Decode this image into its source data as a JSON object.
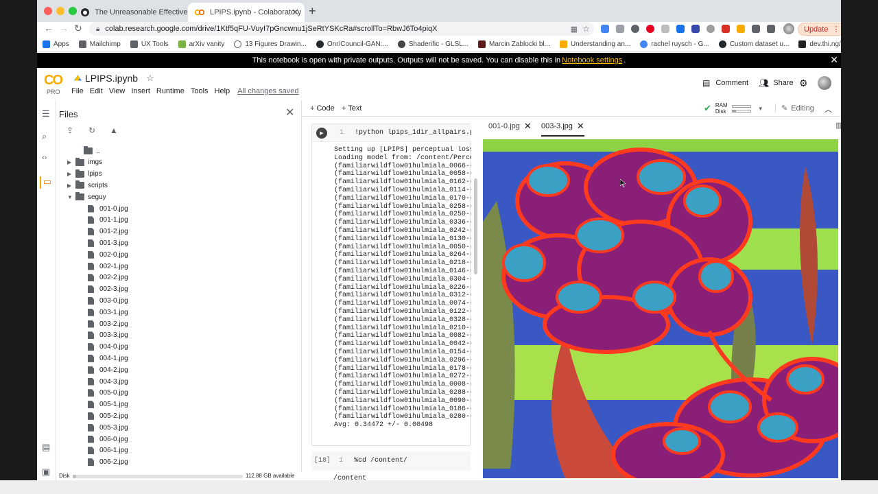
{
  "browser": {
    "tabs": [
      {
        "title": "The Unreasonable Effectiveness",
        "icon": "github-icon"
      },
      {
        "title": "LPIPS.ipynb - Colaboratory",
        "icon": "colab-icon"
      }
    ],
    "url": "colab.research.google.com/drive/1Ktf5qFU-VuyI7pGncwnu1jSeRtYSKcRa#scrollTo=RbwJ6To4piqX",
    "update_label": "Update",
    "bookmarks": [
      "Apps",
      "Mailchimp",
      "UX Tools",
      "arXiv vanity",
      "13 Figures Drawin...",
      "Onr/Council-GAN:...",
      "Shaderific - GLSL...",
      "Marcin Zablocki bl...",
      "Understanding an...",
      "rachel ruysch - G...",
      "Custom dataset u...",
      "dev.thi.ng/gradien..."
    ]
  },
  "banner": {
    "text_before": "This notebook is open with private outputs. Outputs will not be saved. You can disable this in",
    "link": "Notebook settings",
    "text_after": "."
  },
  "colab": {
    "logo": "CO",
    "tier": "PRO",
    "notebook_name": "LPIPS.ipynb",
    "menu": [
      "File",
      "Edit",
      "View",
      "Insert",
      "Runtime",
      "Tools",
      "Help"
    ],
    "saved_status": "All changes saved",
    "comment_label": "Comment",
    "share_label": "Share",
    "add_code_label": "Code",
    "add_text_label": "Text",
    "ram_label": "RAM",
    "disk_label": "Disk",
    "editing_label": "Editing"
  },
  "files_panel": {
    "title": "Files",
    "tree": [
      {
        "name": "..",
        "type": "up",
        "depth": 0
      },
      {
        "name": "imgs",
        "type": "folder",
        "depth": 1,
        "expanded": false
      },
      {
        "name": "lpips",
        "type": "folder",
        "depth": 1,
        "expanded": false
      },
      {
        "name": "scripts",
        "type": "folder",
        "depth": 1,
        "expanded": false
      },
      {
        "name": "seguy",
        "type": "folder",
        "depth": 1,
        "expanded": true
      },
      {
        "name": "001-0.jpg",
        "type": "file",
        "depth": 2
      },
      {
        "name": "001-1.jpg",
        "type": "file",
        "depth": 2
      },
      {
        "name": "001-2.jpg",
        "type": "file",
        "depth": 2
      },
      {
        "name": "001-3.jpg",
        "type": "file",
        "depth": 2
      },
      {
        "name": "002-0.jpg",
        "type": "file",
        "depth": 2
      },
      {
        "name": "002-1.jpg",
        "type": "file",
        "depth": 2
      },
      {
        "name": "002-2.jpg",
        "type": "file",
        "depth": 2
      },
      {
        "name": "002-3.jpg",
        "type": "file",
        "depth": 2
      },
      {
        "name": "003-0.jpg",
        "type": "file",
        "depth": 2
      },
      {
        "name": "003-1.jpg",
        "type": "file",
        "depth": 2
      },
      {
        "name": "003-2.jpg",
        "type": "file",
        "depth": 2
      },
      {
        "name": "003-3.jpg",
        "type": "file",
        "depth": 2
      },
      {
        "name": "004-0.jpg",
        "type": "file",
        "depth": 2
      },
      {
        "name": "004-1.jpg",
        "type": "file",
        "depth": 2
      },
      {
        "name": "004-2.jpg",
        "type": "file",
        "depth": 2
      },
      {
        "name": "004-3.jpg",
        "type": "file",
        "depth": 2
      },
      {
        "name": "005-0.jpg",
        "type": "file",
        "depth": 2
      },
      {
        "name": "005-1.jpg",
        "type": "file",
        "depth": 2
      },
      {
        "name": "005-2.jpg",
        "type": "file",
        "depth": 2
      },
      {
        "name": "005-3.jpg",
        "type": "file",
        "depth": 2
      },
      {
        "name": "006-0.jpg",
        "type": "file",
        "depth": 2
      },
      {
        "name": "006-1.jpg",
        "type": "file",
        "depth": 2
      },
      {
        "name": "006-2.jpg",
        "type": "file",
        "depth": 2
      }
    ],
    "disk_label": "Disk",
    "disk_available": "112.88 GB available",
    "disk_used_fraction": 0.02
  },
  "notebook": {
    "cell1": {
      "line_no": "1",
      "code": "!python lpips_1dir_allpairs.p",
      "output_head": [
        "Setting up [LPIPS] perceptual loss",
        "Loading model from: /content/Perce"
      ],
      "pairs": [
        "0066",
        "0058",
        "0162",
        "0114",
        "0170",
        "0258",
        "0250",
        "0336",
        "0242",
        "0130",
        "0050",
        "0264",
        "0218",
        "0146",
        "0304",
        "0226",
        "0312",
        "0074",
        "0122",
        "0328",
        "0210",
        "0082",
        "0042",
        "0154",
        "0296",
        "0178",
        "0272",
        "0008",
        "0288",
        "0090",
        "0186",
        "0280"
      ],
      "pair_prefix": "(familiarwildflow01hulmiala_",
      "pair_suffix": "-(",
      "avg": "Avg: 0.34472 +/- 0.00498"
    },
    "cell2": {
      "exec_index": "[18]",
      "line_no": "1",
      "code": "%cd /content/",
      "output": "/content"
    }
  },
  "viewer": {
    "tabs": [
      "001-0.jpg",
      "003-3.jpg"
    ],
    "active_tab": 1
  },
  "colors": {
    "accent": "#f9ab00",
    "banner_link": "#fbbc04",
    "ok_check": "#34a853"
  }
}
